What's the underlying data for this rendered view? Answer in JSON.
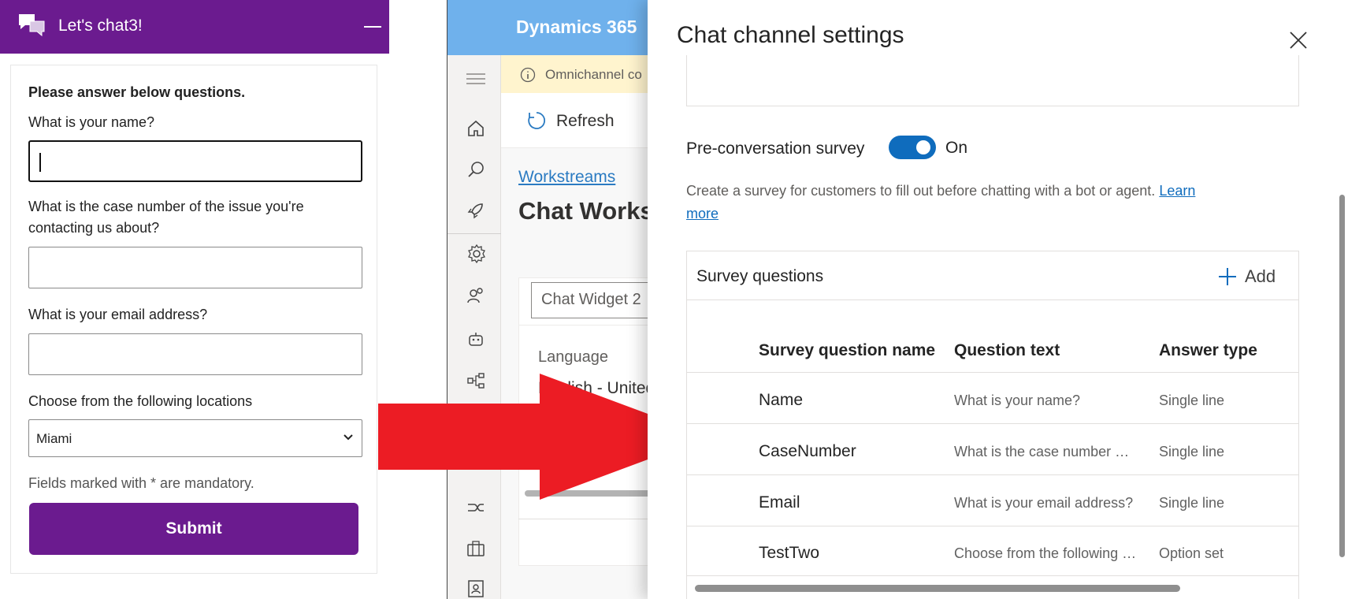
{
  "chat_widget": {
    "title": "Let's chat3!",
    "heading": "Please answer below questions.",
    "q1_label": "What is your name?",
    "q1_value": "",
    "q2_label_line1": "What is the case number of the issue you're",
    "q2_label_line2": "contacting us about?",
    "q3_label": "What is your email address?",
    "q4_label": "Choose from the following locations",
    "q4_selected": "Miami",
    "mandatory_note": "Fields marked with * are mandatory.",
    "submit_label": "Submit"
  },
  "dynamics": {
    "brand": "Dynamics 365",
    "notice": "Omnichannel co",
    "refresh_label": "Refresh",
    "breadcrumb": "Workstreams",
    "page_title": "Chat Workst",
    "widget_input_value": "Chat Widget 2",
    "language_label": "Language",
    "language_value": "English - United"
  },
  "panel": {
    "title": "Chat channel settings",
    "survey_label": "Pre-conversation survey",
    "survey_state": "On",
    "survey_desc": "Create a survey for customers to fill out before chatting with a bot or agent.",
    "learn_more_1": "Learn",
    "learn_more_2": "more",
    "grid_title": "Survey questions",
    "add_label": "Add",
    "columns": {
      "name": "Survey question name",
      "text": "Question text",
      "type": "Answer type"
    },
    "rows": [
      {
        "name": "Name",
        "text": "What is your name?",
        "type": "Single line"
      },
      {
        "name": "CaseNumber",
        "text": "What is the case number of the issue you're contacting us about?",
        "type": "Single line"
      },
      {
        "name": "Email",
        "text": "What is your email address?",
        "type": "Single line"
      },
      {
        "name": "TestTwo",
        "text": "Choose from the following locations",
        "type": "Option set"
      }
    ]
  },
  "colors": {
    "chat_purple": "#6b1b8f",
    "dynamics_blue": "#6fb1ec",
    "toggle_blue": "#0f6cbd",
    "arrow_red": "#ec1c24"
  }
}
